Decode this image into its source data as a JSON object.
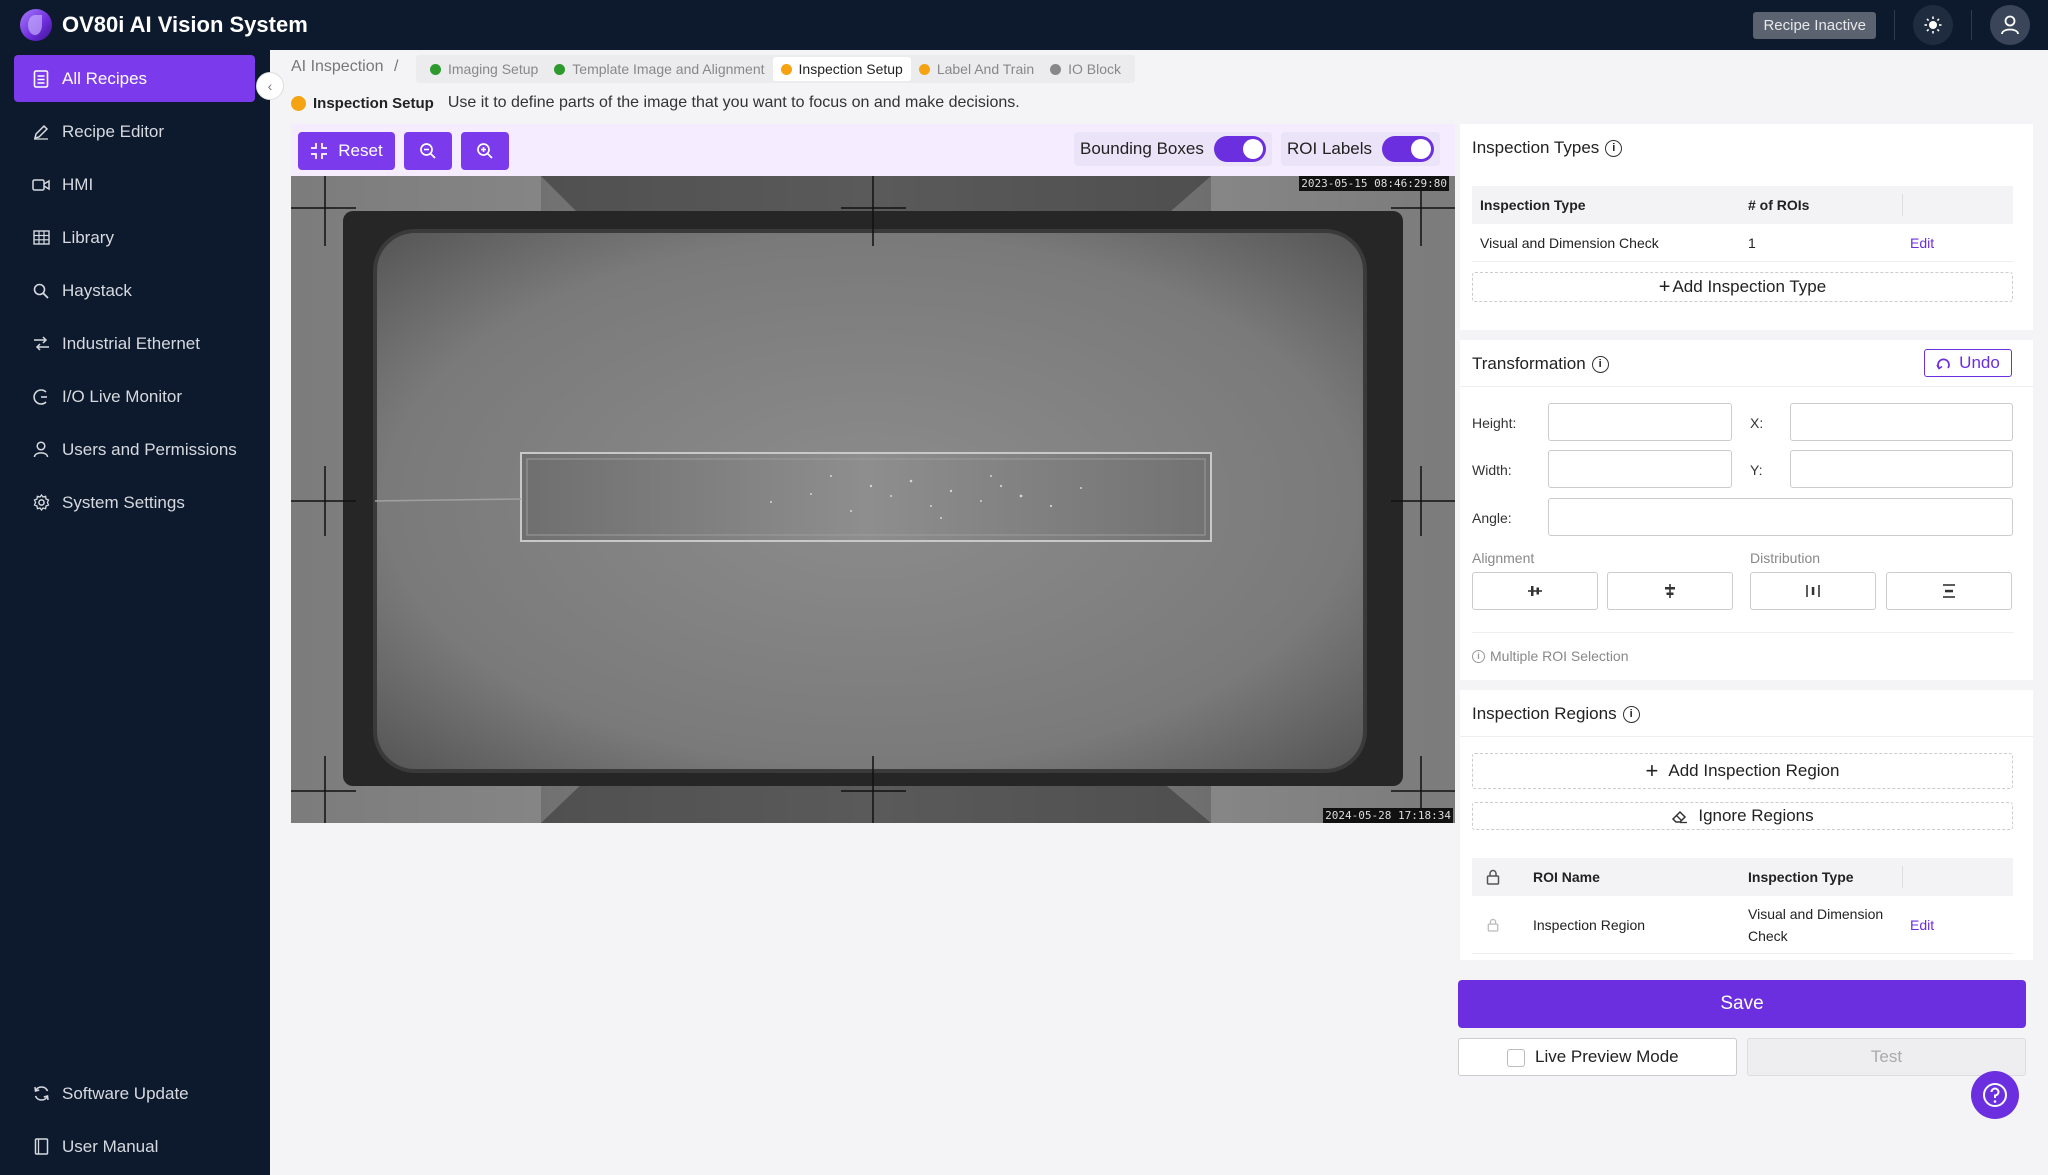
{
  "app": {
    "title": "OV80i AI Vision System",
    "recipe_status": "Recipe Inactive"
  },
  "sidebar": {
    "items": [
      {
        "label": "All Recipes",
        "icon": "document-icon",
        "active": true
      },
      {
        "label": "Recipe Editor",
        "icon": "pencil-icon"
      },
      {
        "label": "HMI",
        "icon": "video-icon"
      },
      {
        "label": "Library",
        "icon": "grid-icon"
      },
      {
        "label": "Haystack",
        "icon": "search-icon"
      },
      {
        "label": "Industrial Ethernet",
        "icon": "ethernet-icon"
      },
      {
        "label": "I/O Live Monitor",
        "icon": "monitor-icon"
      },
      {
        "label": "Users and Permissions",
        "icon": "user-icon"
      },
      {
        "label": "System Settings",
        "icon": "gear-icon"
      }
    ],
    "bottom_items": [
      {
        "label": "Software Update",
        "icon": "refresh-icon"
      },
      {
        "label": "User Manual",
        "icon": "book-icon"
      }
    ]
  },
  "breadcrumb": {
    "root": "AI Inspection",
    "separator": "/",
    "steps": [
      {
        "label": "Imaging Setup",
        "color": "#2e9a2e"
      },
      {
        "label": "Template Image and Alignment",
        "color": "#2e9a2e"
      },
      {
        "label": "Inspection Setup",
        "color": "#f5a313",
        "active": true
      },
      {
        "label": "Label And Train",
        "color": "#f5a313"
      },
      {
        "label": "IO Block",
        "color": "#888888"
      }
    ]
  },
  "step_header": {
    "title": "Inspection Setup",
    "description": "Use it to define parts of the image that you want to focus on and make decisions.",
    "color": "#f5a313"
  },
  "toolbar": {
    "reset_label": "Reset",
    "bounding_boxes_label": "Bounding Boxes",
    "bounding_boxes_on": true,
    "roi_labels_label": "ROI Labels",
    "roi_labels_on": true
  },
  "image": {
    "timestamp_top": "2023-05-15 08:46:29:80",
    "timestamp_bottom": "2024-05-28 17:18:34"
  },
  "inspection_types": {
    "title": "Inspection Types",
    "columns": [
      "Inspection Type",
      "# of ROIs"
    ],
    "rows": [
      {
        "type": "Visual and Dimension Check",
        "count": "1",
        "action": "Edit"
      }
    ],
    "add_label": "Add Inspection Type"
  },
  "transformation": {
    "title": "Transformation",
    "undo_label": "Undo",
    "height_label": "Height:",
    "width_label": "Width:",
    "x_label": "X:",
    "y_label": "Y:",
    "angle_label": "Angle:",
    "height_value": "",
    "width_value": "",
    "x_value": "",
    "y_value": "",
    "angle_value": "",
    "alignment_label": "Alignment",
    "distribution_label": "Distribution",
    "multi_roi_label": "Multiple ROI Selection"
  },
  "inspection_regions": {
    "title": "Inspection Regions",
    "add_label": "Add Inspection Region",
    "ignore_label": "Ignore Regions",
    "columns": [
      "ROI Name",
      "Inspection Type"
    ],
    "rows": [
      {
        "name": "Inspection Region",
        "type_line1": "Visual and Dimension",
        "type_line2": "Check",
        "action": "Edit"
      }
    ]
  },
  "actions": {
    "save_label": "Save",
    "live_preview_label": "Live Preview Mode",
    "live_preview_checked": false,
    "test_label": "Test"
  },
  "colors": {
    "accent": "#7c3aed",
    "nav_bg": "#0d1a2d"
  }
}
